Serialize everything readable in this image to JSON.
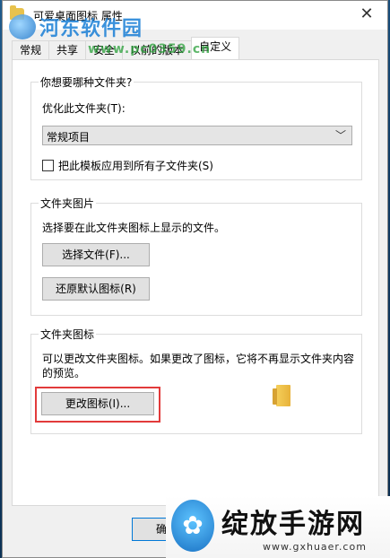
{
  "window": {
    "title": "可爱桌面图标 属性",
    "close_glyph": "✕"
  },
  "watermark": {
    "site_name": "河东软件园",
    "url": "www.pc0359.cn"
  },
  "tabs": [
    {
      "label": "常规"
    },
    {
      "label": "共享"
    },
    {
      "label": "安全"
    },
    {
      "label": "以前的版本"
    },
    {
      "label": "自定义"
    }
  ],
  "optimize_group": {
    "title": "你想要哪种文件夹?",
    "optimize_label": "优化此文件夹(T):",
    "optimize_value": "常规项目",
    "apply_subfolders_label": "把此模板应用到所有子文件夹(S)"
  },
  "picture_group": {
    "title": "文件夹图片",
    "description": "选择要在此文件夹图标上显示的文件。",
    "choose_file_button": "选择文件(F)...",
    "restore_default_button": "还原默认图标(R)"
  },
  "icon_group": {
    "title": "文件夹图标",
    "description_line1": "可以更改文件夹图标。如果更改了图标，它将不再显示文件夹内容",
    "description_line2": "的预览。",
    "change_icon_button": "更改图标(I)..."
  },
  "footer": {
    "ok_partial": "确"
  },
  "promo": {
    "logo_glyph": "✿",
    "title": "绽放手游网",
    "url": "www.gxhuaer.com"
  }
}
